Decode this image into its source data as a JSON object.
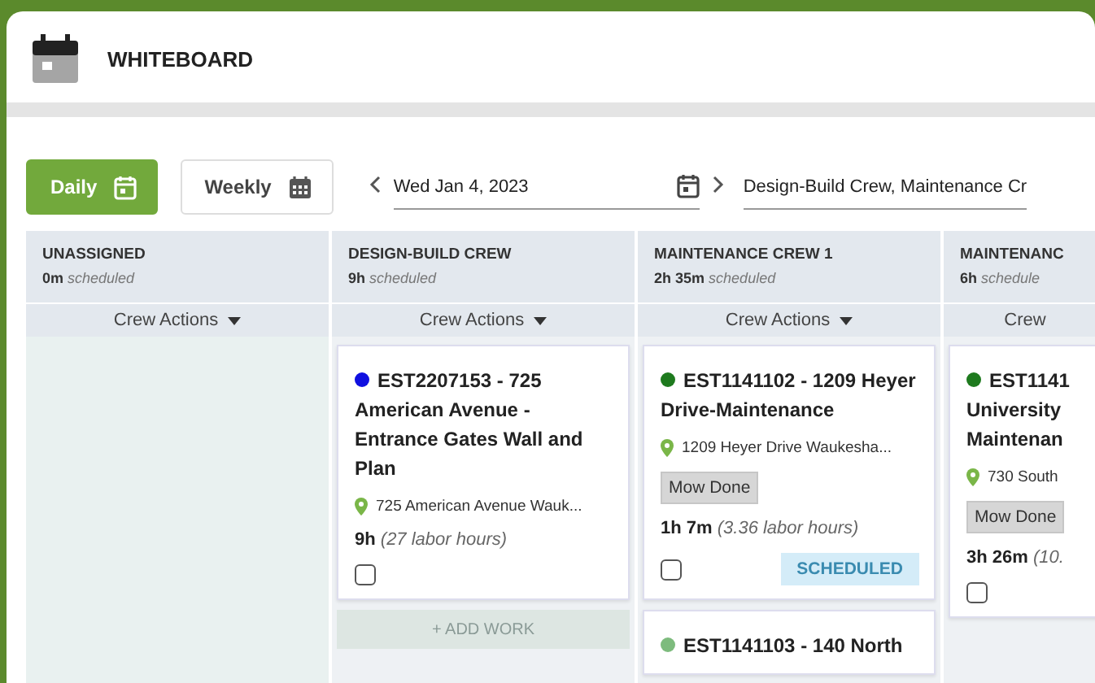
{
  "app": {
    "title": "WHITEBOARD"
  },
  "view_toggle": [
    {
      "label": "Daily",
      "selected": true
    },
    {
      "label": "Weekly",
      "selected": false
    }
  ],
  "date": {
    "value": "Wed Jan 4, 2023"
  },
  "crew_filter": {
    "value": "Design-Build Crew, Maintenance Cr"
  },
  "columns": [
    {
      "name": "UNASSIGNED",
      "time": "0m",
      "time_label": "scheduled",
      "actions": "Crew Actions"
    },
    {
      "name": "DESIGN-BUILD CREW",
      "time": "9h",
      "time_label": "scheduled",
      "actions": "Crew Actions",
      "add_work": "+ ADD WORK",
      "cards": [
        {
          "color": "#1010e0",
          "title": "EST2207153 - 725 American Avenue - Entrance Gates Wall and Plan",
          "address": "725 American Avenue Wauk...",
          "duration": "9h",
          "labor": "(27 labor hours)",
          "checked": false
        }
      ]
    },
    {
      "name": "MAINTENANCE CREW 1",
      "time": "2h 35m",
      "time_label": "scheduled",
      "actions": "Crew Actions",
      "cards": [
        {
          "color": "#1e7a1e",
          "title": "EST1141102 - 1209 Heyer Drive-Maintenance",
          "address": "1209 Heyer Drive Waukesha...",
          "tag": "Mow Done",
          "duration": "1h 7m",
          "labor": "(3.36 labor hours)",
          "checked": false,
          "status": "SCHEDULED"
        },
        {
          "color": "#7dbb7d",
          "title": "EST1141103 - 140 North"
        }
      ]
    },
    {
      "name": "MAINTENANC",
      "time": "6h",
      "time_label": "schedule",
      "actions": "Crew",
      "cards": [
        {
          "color": "#1e7a1e",
          "title": "EST1141 University Maintenan",
          "address": "730 South",
          "tag": "Mow Done",
          "duration": "3h 26m",
          "labor": "(10.",
          "checked": false
        }
      ]
    }
  ]
}
